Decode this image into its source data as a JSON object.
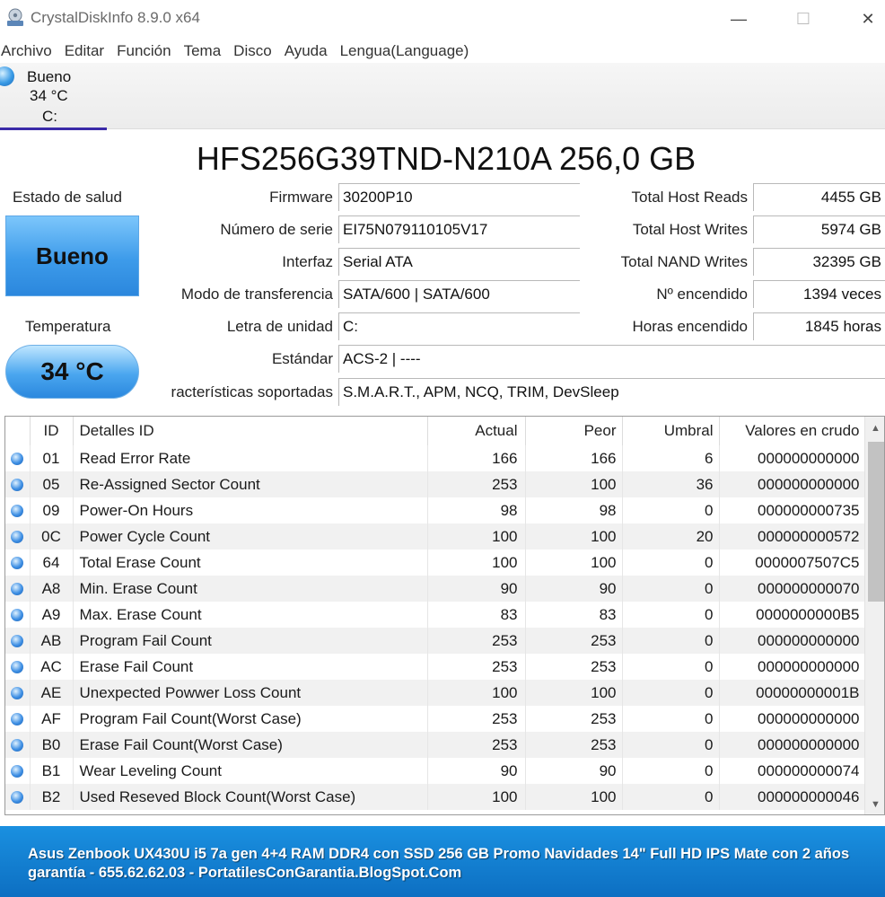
{
  "window": {
    "title": "CrystalDiskInfo 8.9.0 x64",
    "minimize_glyph": "—",
    "maximize_glyph": "☐",
    "close_glyph": "✕"
  },
  "menu": [
    "Archivo",
    "Editar",
    "Función",
    "Tema",
    "Disco",
    "Ayuda",
    "Lengua(Language)"
  ],
  "disk_tab": {
    "status": "Bueno",
    "temperature": "34 °C",
    "drive": "C:"
  },
  "model_title": "HFS256G39TND-N210A 256,0 GB",
  "health": {
    "label": "Estado de salud",
    "value": "Bueno",
    "color": "#3d9bea"
  },
  "temperature": {
    "label": "Temperatura",
    "value": "34 °C"
  },
  "info": {
    "firmware_label": "Firmware",
    "firmware": "30200P10",
    "serial_label": "Número de serie",
    "serial": "EI75N079110105V17",
    "interface_label": "Interfaz",
    "interface": "Serial ATA",
    "transfer_label": "Modo de transferencia",
    "transfer": "SATA/600 | SATA/600",
    "drive_letter_label": "Letra de unidad",
    "drive_letter": "C:",
    "standard_label": "Estándar",
    "standard": "ACS-2 | ----",
    "features_label": "racterísticas soportadas",
    "features": "S.M.A.R.T., APM, NCQ, TRIM, DevSleep",
    "host_reads_label": "Total Host Reads",
    "host_reads": "4455 GB",
    "host_writes_label": "Total Host Writes",
    "host_writes": "5974 GB",
    "nand_writes_label": "Total NAND Writes",
    "nand_writes": "32395 GB",
    "power_on_count_label": "Nº encendido",
    "power_on_count": "1394 veces",
    "power_on_hours_label": "Horas encendido",
    "power_on_hours": "1845 horas"
  },
  "smart": {
    "headers": {
      "id": "ID",
      "name": "Detalles ID",
      "current": "Actual",
      "worst": "Peor",
      "threshold": "Umbral",
      "raw": "Valores en crudo"
    },
    "rows": [
      {
        "id": "01",
        "name": "Read Error Rate",
        "current": "166",
        "worst": "166",
        "threshold": "6",
        "raw": "000000000000"
      },
      {
        "id": "05",
        "name": "Re-Assigned Sector Count",
        "current": "253",
        "worst": "100",
        "threshold": "36",
        "raw": "000000000000"
      },
      {
        "id": "09",
        "name": "Power-On Hours",
        "current": "98",
        "worst": "98",
        "threshold": "0",
        "raw": "000000000735"
      },
      {
        "id": "0C",
        "name": "Power Cycle Count",
        "current": "100",
        "worst": "100",
        "threshold": "20",
        "raw": "000000000572"
      },
      {
        "id": "64",
        "name": "Total Erase Count",
        "current": "100",
        "worst": "100",
        "threshold": "0",
        "raw": "0000007507C5"
      },
      {
        "id": "A8",
        "name": "Min. Erase Count",
        "current": "90",
        "worst": "90",
        "threshold": "0",
        "raw": "000000000070"
      },
      {
        "id": "A9",
        "name": "Max. Erase Count",
        "current": "83",
        "worst": "83",
        "threshold": "0",
        "raw": "0000000000B5"
      },
      {
        "id": "AB",
        "name": "Program Fail Count",
        "current": "253",
        "worst": "253",
        "threshold": "0",
        "raw": "000000000000"
      },
      {
        "id": "AC",
        "name": "Erase Fail Count",
        "current": "253",
        "worst": "253",
        "threshold": "0",
        "raw": "000000000000"
      },
      {
        "id": "AE",
        "name": "Unexpected Powwer Loss Count",
        "current": "100",
        "worst": "100",
        "threshold": "0",
        "raw": "00000000001B"
      },
      {
        "id": "AF",
        "name": "Program Fail Count(Worst Case)",
        "current": "253",
        "worst": "253",
        "threshold": "0",
        "raw": "000000000000"
      },
      {
        "id": "B0",
        "name": "Erase Fail Count(Worst Case)",
        "current": "253",
        "worst": "253",
        "threshold": "0",
        "raw": "000000000000"
      },
      {
        "id": "B1",
        "name": "Wear Leveling Count",
        "current": "90",
        "worst": "90",
        "threshold": "0",
        "raw": "000000000074"
      },
      {
        "id": "B2",
        "name": "Used Reseved Block Count(Worst Case)",
        "current": "100",
        "worst": "100",
        "threshold": "0",
        "raw": "000000000046"
      }
    ]
  },
  "banner": {
    "line1": "Asus Zenbook UX430U i5 7a gen 4+4 RAM DDR4 con SSD 256 GB Promo Navidades 14\" Full HD IPS Mate con 2 años",
    "line2": "garantía - 655.62.62.03 - PortatilesConGarantia.BlogSpot.Com"
  }
}
